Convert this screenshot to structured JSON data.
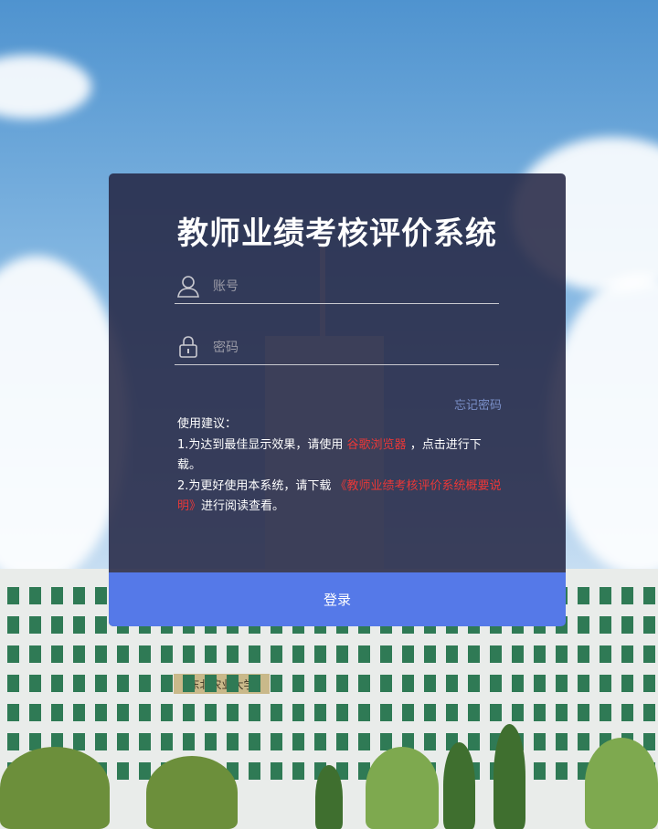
{
  "login": {
    "title": "教师业绩考核评价系统",
    "account_placeholder": "账号",
    "password_placeholder": "密码",
    "forgot_password": "忘记密码",
    "login_button": "登录",
    "account_icon": "user-icon",
    "password_icon": "lock-icon"
  },
  "tips": {
    "heading": "使用建议：",
    "tip1_prefix": "1.为达到最佳显示效果，请使用",
    "tip1_link": "谷歌浏览器",
    "tip1_suffix": "，点击进行下载。",
    "tip2_prefix": "2.为更好使用本系统，请下载",
    "tip2_link": "《教师业绩考核评价系统概要说明》",
    "tip2_suffix": "进行阅读查看。"
  },
  "background": {
    "building_sign": "东北农业大学"
  },
  "colors": {
    "card_bg": "#262846",
    "button": "#5579e8",
    "link_red": "#e83838",
    "forgot_link": "#7a8fc8"
  }
}
